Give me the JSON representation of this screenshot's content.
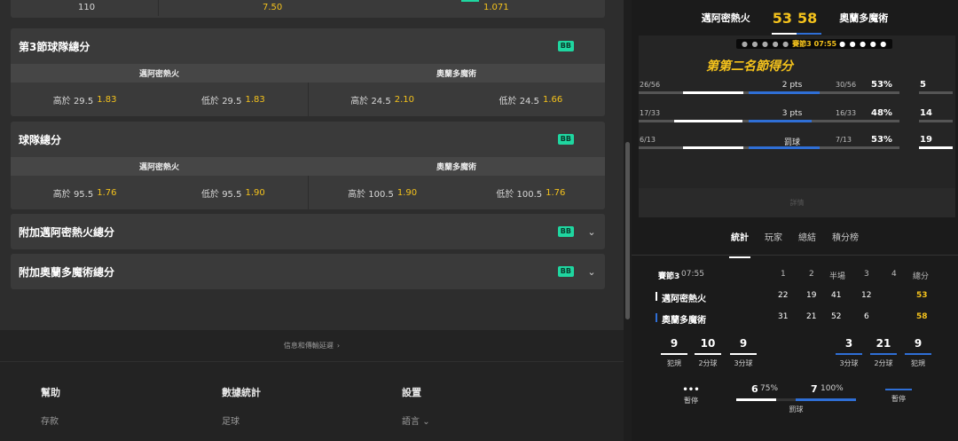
{
  "top_row": {
    "v1": "110",
    "v2": "7.50",
    "v3": "1.071"
  },
  "markets": [
    {
      "title": "第3節球隊總分",
      "badge": "BB",
      "teams": [
        "邁阿密熱火",
        "奧蘭多魔術"
      ],
      "odds": [
        {
          "label": "高於 29.5",
          "price": "1.83"
        },
        {
          "label": "低於 29.5",
          "price": "1.83"
        },
        {
          "label": "高於 24.5",
          "price": "2.10"
        },
        {
          "label": "低於 24.5",
          "price": "1.66"
        }
      ]
    },
    {
      "title": "球隊總分",
      "badge": "BB",
      "teams": [
        "邁阿密熱火",
        "奧蘭多魔術"
      ],
      "odds": [
        {
          "label": "高於 95.5",
          "price": "1.76"
        },
        {
          "label": "低於 95.5",
          "price": "1.90"
        },
        {
          "label": "高於 100.5",
          "price": "1.90"
        },
        {
          "label": "低於 100.5",
          "price": "1.76"
        }
      ]
    },
    {
      "title": "附加邁阿密熱火總分",
      "badge": "BB"
    },
    {
      "title": "附加奧蘭多魔術總分",
      "badge": "BB"
    }
  ],
  "footer": {
    "delay_text": "信息和傳輸延遲",
    "columns": [
      {
        "header": "幫助",
        "link": "存款"
      },
      {
        "header": "數據統計",
        "link": "足球"
      },
      {
        "header": "設置",
        "link": "語言"
      }
    ]
  },
  "score": {
    "home": "邁阿密熱火",
    "home_score": "53",
    "away_score": "58",
    "away": "奧蘭多魔術"
  },
  "viz": {
    "clock_label": "賽節3",
    "clock_time": "07:55",
    "quarter_title": "第第二名節得分",
    "rows": [
      {
        "left": "26/56",
        "label": "2 pts",
        "right": "30/56",
        "pct": "53%",
        "num": "5",
        "home_frac": 0.46,
        "away_frac": 0.54
      },
      {
        "left": "17/33",
        "label": "3 pts",
        "right": "16/33",
        "pct": "48%",
        "num": "14",
        "home_frac": 0.52,
        "away_frac": 0.48
      },
      {
        "left": "6/13",
        "label": "罰球",
        "right": "7/13",
        "pct": "53%",
        "num": "19",
        "home_frac": 0.46,
        "away_frac": 0.54
      }
    ],
    "note": "詳情"
  },
  "tabs": [
    "統計",
    "玩家",
    "總結",
    "積分榜"
  ],
  "table": {
    "header": {
      "period": "賽節3",
      "time": "07:55",
      "cols": [
        "1",
        "2",
        "半場",
        "3",
        "4",
        "總分"
      ]
    },
    "rows": [
      {
        "team": "邁阿密熱火",
        "vals": [
          "22",
          "19",
          "41",
          "12",
          "",
          "53"
        ],
        "color": "#ffffff"
      },
      {
        "team": "奧蘭多魔術",
        "vals": [
          "31",
          "21",
          "52",
          "6",
          "",
          "58"
        ],
        "color": "#2f6fd6"
      }
    ]
  },
  "team_stats": {
    "home": [
      {
        "value": "9",
        "label": "犯規"
      },
      {
        "value": "10",
        "label": "2分球"
      },
      {
        "value": "9",
        "label": "3分球"
      }
    ],
    "away": [
      {
        "value": "3",
        "label": "3分球"
      },
      {
        "value": "21",
        "label": "2分球"
      },
      {
        "value": "9",
        "label": "犯規"
      }
    ]
  },
  "bottom_stats": {
    "timeout_label": "暫停",
    "free_throw_label": "罰球",
    "home_ft": "6",
    "home_ft_pct": "75%",
    "away_ft": "7",
    "away_ft_pct": "100%",
    "home_ft_frac": 0.75,
    "away_ft_frac": 1.0
  },
  "colors": {
    "accent_yellow": "#f4c21c",
    "home": "#ffffff",
    "away": "#2f6fd6",
    "badge": "#1fd6a0"
  }
}
